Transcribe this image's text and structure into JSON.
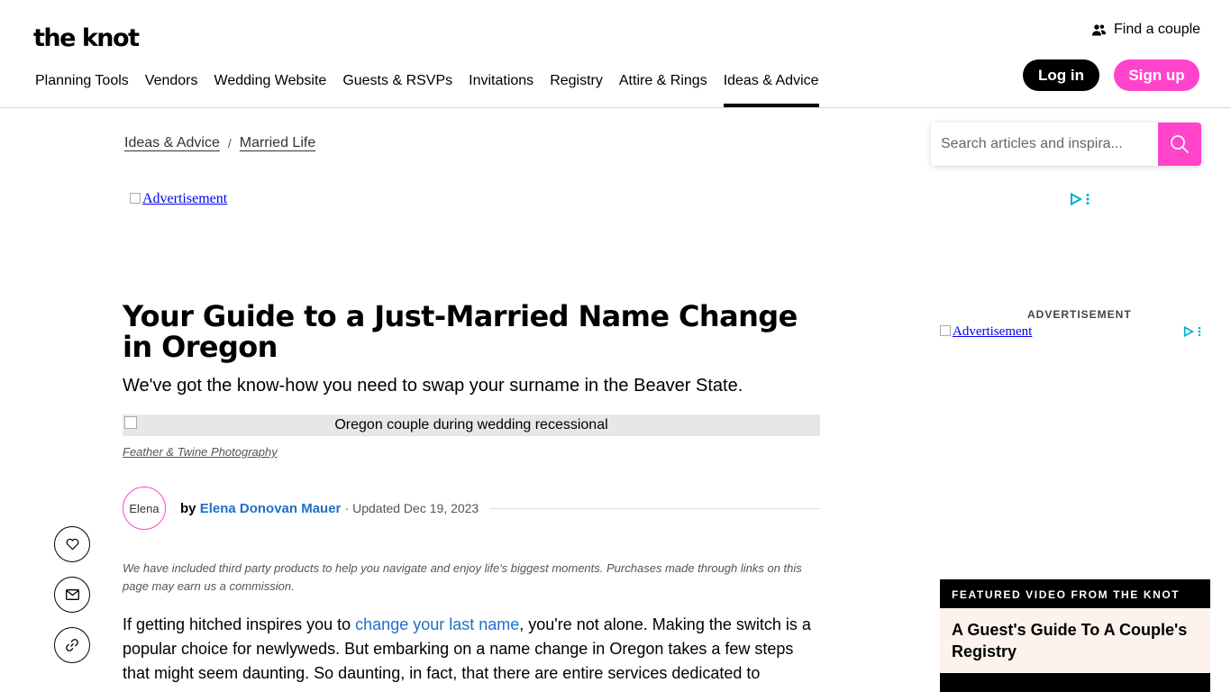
{
  "header": {
    "logo": "the knot",
    "find_couple": "Find a couple",
    "nav": [
      "Planning Tools",
      "Vendors",
      "Wedding Website",
      "Guests & RSVPs",
      "Invitations",
      "Registry",
      "Attire & Rings",
      "Ideas & Advice"
    ],
    "active_nav": "Ideas & Advice",
    "login": "Log in",
    "signup": "Sign up"
  },
  "breadcrumb": {
    "items": [
      "Ideas & Advice",
      "Married Life"
    ],
    "separator": "/"
  },
  "search": {
    "placeholder": "Search articles and inspira..."
  },
  "ads": {
    "top": "Advertisement",
    "side_label": "ADVERTISEMENT",
    "side": "Advertisement"
  },
  "article": {
    "title": "Your Guide to a Just-Married Name Change in Oregon",
    "subtitle": "We've got the know-how you need to swap your surname in the Beaver State.",
    "hero_alt": "Oregon couple during wedding recessional",
    "photo_credit": "Feather & Twine Photography",
    "avatar_alt": "Elena",
    "by": "by",
    "author": "Elena Donovan Mauer",
    "updated": "· Updated Dec 19, 2023",
    "disclaimer": "We have included third party products to help you navigate and enjoy life's biggest moments. Purchases made through links on this page may earn us a commission.",
    "body_before": "If getting hitched inspires you to ",
    "body_link": "change your last name",
    "body_after": ", you're not alone. Making the switch is a popular choice for newlyweds. But embarking on a name change in Oregon takes a few steps that might seem daunting. So daunting, in fact, that there are entire services dedicated to"
  },
  "featured": {
    "heading": "FEATURED VIDEO FROM THE KNOT",
    "title": "A Guest's Guide To A Couple's Registry"
  },
  "colors": {
    "brand_pink": "#ff44cb",
    "link_blue": "#1f6fc9",
    "adchoice_blue": "#00aecd"
  }
}
